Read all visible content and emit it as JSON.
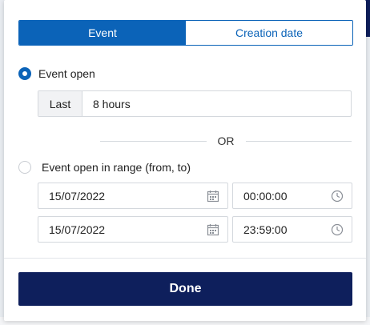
{
  "tabs": [
    {
      "label": "Event",
      "active": true
    },
    {
      "label": "Creation date",
      "active": false
    }
  ],
  "options": {
    "event_open": {
      "label": "Event open",
      "selected": true
    },
    "event_open_range": {
      "label": "Event open in range (from, to)",
      "selected": false
    }
  },
  "last": {
    "label": "Last",
    "value": "8 hours"
  },
  "separator": "OR",
  "range": {
    "from": {
      "date": "15/07/2022",
      "time": "00:00:00"
    },
    "to": {
      "date": "15/07/2022",
      "time": "23:59:00"
    }
  },
  "done_label": "Done",
  "icons": {
    "date": "calendar-icon",
    "time": "clock-icon"
  },
  "colors": {
    "accent": "#0b63b8",
    "done": "#0e1f5c",
    "border": "#d4d8dd"
  }
}
